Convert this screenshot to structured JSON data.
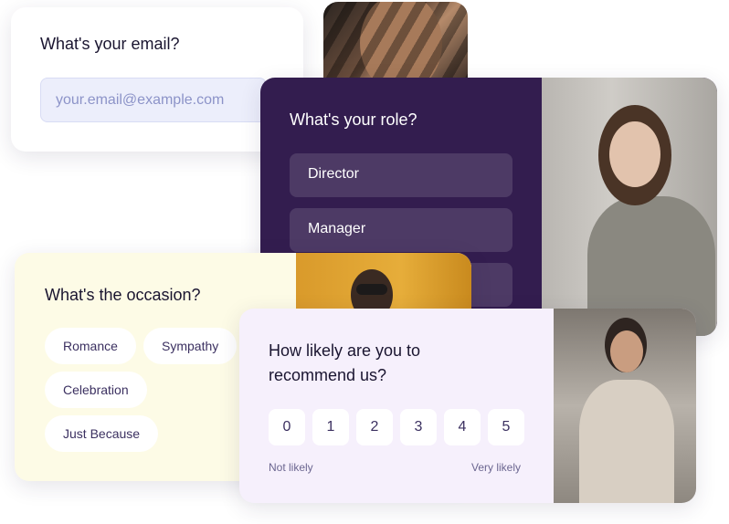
{
  "email_card": {
    "question": "What's your email?",
    "placeholder": "your.email@example.com"
  },
  "role_card": {
    "question": "What's your role?",
    "options": [
      "Director",
      "Manager",
      ""
    ]
  },
  "occasion_card": {
    "question": "What's the occasion?",
    "options": [
      "Romance",
      "Sympathy",
      "Celebration",
      "Just Because"
    ]
  },
  "recommend_card": {
    "question_line1": "How likely are you to",
    "question_line2": "recommend us?",
    "scale": [
      "0",
      "1",
      "2",
      "3",
      "4",
      "5"
    ],
    "low_label": "Not likely",
    "high_label": "Very likely"
  },
  "colors": {
    "role_bg": "#331d4f",
    "occasion_bg": "#fdfbe6",
    "recommend_bg": "#f6f0fc",
    "input_bg": "#eceefb"
  }
}
